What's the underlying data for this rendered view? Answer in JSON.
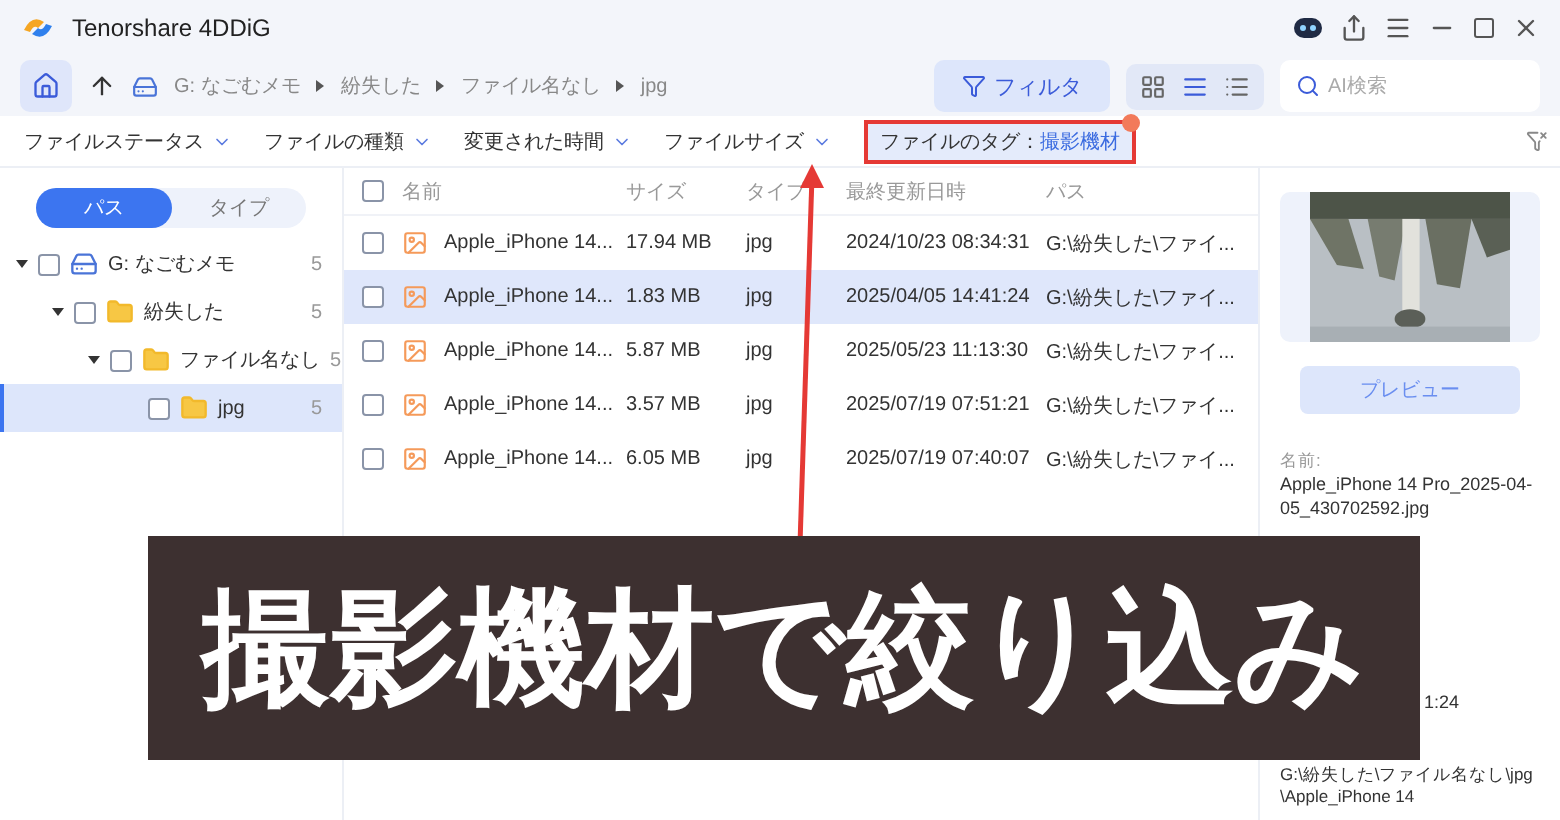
{
  "window": {
    "title": "Tenorshare 4DDiG"
  },
  "breadcrumb": [
    "G: なごむメモ",
    "紛失した",
    "ファイル名なし",
    "jpg"
  ],
  "toolbar": {
    "filter_button": "フィルタ",
    "views": [
      {
        "kind": "grid",
        "selected": false
      },
      {
        "kind": "detail",
        "selected": true
      },
      {
        "kind": "list",
        "selected": false
      }
    ],
    "search": {
      "placeholder": "AI検索"
    }
  },
  "filters": [
    {
      "label": "ファイルステータス"
    },
    {
      "label": "ファイルの種類"
    },
    {
      "label": "変更された時間"
    },
    {
      "label": "ファイルサイズ"
    }
  ],
  "active_tag": {
    "label": "ファイルのタグ：",
    "value": "撮影機材",
    "highlighted": true
  },
  "sidebar": {
    "tabs": [
      {
        "label": "パス",
        "selected": true
      },
      {
        "label": "タイプ",
        "selected": false
      }
    ],
    "tree": [
      {
        "label": "G: なごむメモ",
        "kind": "drive",
        "count": "5",
        "expanded": true,
        "checked": false,
        "selected": false,
        "children": [
          {
            "label": "紛失した",
            "kind": "folder",
            "count": "5",
            "expanded": true,
            "checked": false,
            "selected": false,
            "children": [
              {
                "label": "ファイル名なし",
                "kind": "folder",
                "count": "5",
                "expanded": true,
                "checked": false,
                "selected": false,
                "children": [
                  {
                    "label": "jpg",
                    "kind": "folder",
                    "count": "5",
                    "checked": false,
                    "selected": true
                  }
                ]
              }
            ]
          }
        ]
      }
    ]
  },
  "table": {
    "select_all_checked": false,
    "columns": [
      "名前",
      "サイズ",
      "タイプ",
      "最終更新日時",
      "パス"
    ],
    "rows": [
      {
        "name": "Apple_iPhone 14...",
        "size": "17.94 MB",
        "type": "jpg",
        "modified": "2024/10/23 08:34:31",
        "path": "G:\\紛失した\\ファイ...",
        "checked": false,
        "selected": false
      },
      {
        "name": "Apple_iPhone 14...",
        "size": "1.83 MB",
        "type": "jpg",
        "modified": "2025/04/05 14:41:24",
        "path": "G:\\紛失した\\ファイ...",
        "checked": false,
        "selected": true
      },
      {
        "name": "Apple_iPhone 14...",
        "size": "5.87 MB",
        "type": "jpg",
        "modified": "2025/05/23 11:13:30",
        "path": "G:\\紛失した\\ファイ...",
        "checked": false,
        "selected": false
      },
      {
        "name": "Apple_iPhone 14...",
        "size": "3.57 MB",
        "type": "jpg",
        "modified": "2025/07/19 07:51:21",
        "path": "G:\\紛失した\\ファイ...",
        "checked": false,
        "selected": false
      },
      {
        "name": "Apple_iPhone 14...",
        "size": "6.05 MB",
        "type": "jpg",
        "modified": "2025/07/19 07:40:07",
        "path": "G:\\紛失した\\ファイ...",
        "checked": false,
        "selected": false
      }
    ]
  },
  "details": {
    "preview_button": "プレビュー",
    "name_label": "名前:",
    "name_value": "Apple_iPhone 14 Pro_2025-04-05_430702592.jpg",
    "date_fragment": "1:24",
    "path": "G:\\紛失した\\ファイル名なし\\jpg \\Apple_iPhone 14"
  },
  "annotation": {
    "caption": "撮影機材で絞り込み"
  }
}
